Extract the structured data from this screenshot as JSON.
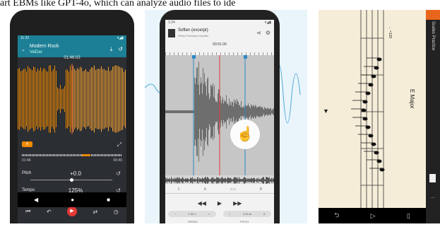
{
  "caption": "art EBMs like GPT-4o, which can analyze audio files to ide",
  "app1": {
    "status_time": "11:22",
    "status_icons": "▾◢▮",
    "track_title": "Modern Rock",
    "track_artist": "ValDar",
    "position_time": "01:46.02",
    "badge": "A",
    "time_left": "01:46",
    "time_right": "00:40",
    "pitch_label": "Pitch",
    "pitch_value": "+0.0",
    "tempo_label": "Tempo",
    "tempo_value": "125%",
    "colors": {
      "header": "#1c7f95",
      "wave": "#f08a00",
      "play": "#e53935"
    }
  },
  "app2": {
    "status_time": "1:24",
    "track_title": "Soften (excerpt)",
    "track_subtitle": "Pietro Francisco Gautier",
    "position_time": "00:01.00",
    "marker_a": "A",
    "marker_b": "B",
    "speed_label": "SPEED",
    "speed_value": "1.00 x",
    "pitch_label": "PITCH",
    "pitch_value": "0.00 st"
  },
  "app3": {
    "app_title": "Scales Practice",
    "key_label": "E Major",
    "tempo_mark": "♩=120"
  }
}
